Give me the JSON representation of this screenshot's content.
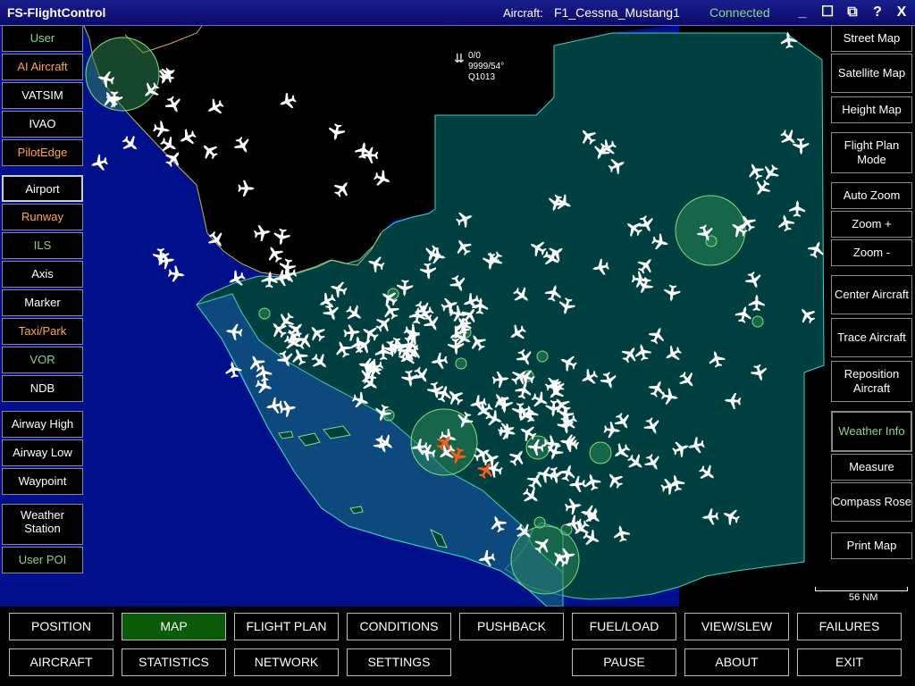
{
  "app_title": "FS-FlightControl",
  "aircraft_label": "Aircraft:",
  "aircraft_name": "F1_Cessna_Mustang1",
  "connection_status": "Connected",
  "window_buttons": [
    "_",
    "☐",
    "⧉",
    "?",
    "X"
  ],
  "left_panel": {
    "traffic": [
      "User",
      "AI Aircraft",
      "VATSIM",
      "IVAO",
      "PilotEdge"
    ],
    "nav": [
      "Airport",
      "Runway",
      "ILS",
      "Axis",
      "Marker",
      "Taxi/Park",
      "VOR",
      "NDB"
    ],
    "airways": [
      "Airway High",
      "Airway Low",
      "Waypoint"
    ],
    "weather_station": "Weather\nStation",
    "user_poi": "User POI"
  },
  "right_panel": {
    "street_map": "Street Map",
    "satellite_map": "Satellite Map",
    "height_map": "Height Map",
    "flight_plan_mode": "Flight Plan Mode",
    "auto_zoom": "Auto Zoom",
    "zoom_in": "Zoom +",
    "zoom_out": "Zoom -",
    "center_aircraft": "Center Aircraft",
    "trace_aircraft": "Trace Aircraft",
    "reposition_aircraft": "Reposition Aircraft",
    "weather_info": "Weather Info",
    "measure": "Measure",
    "compass_rose": "Compass Rose",
    "print_map": "Print Map"
  },
  "wind": {
    "line1": "0/0",
    "line2": "9999/54°",
    "line3": "Q1013"
  },
  "scale": "56 NM",
  "bottom_row1": [
    "POSITION",
    "MAP",
    "FLIGHT PLAN",
    "CONDITIONS",
    "PUSHBACK",
    "FUEL/LOAD",
    "VIEW/SLEW",
    "FAILURES"
  ],
  "bottom_row2": [
    "AIRCRAFT",
    "STATISTICS",
    "NETWORK",
    "SETTINGS",
    "",
    "PAUSE",
    "ABOUT",
    "EXIT"
  ],
  "active_tab": "MAP",
  "colors": {
    "title_bar": "#0a0a6a",
    "land": "#003f3f",
    "ocean": "#00108a",
    "airspace_fill": "#1a52b0",
    "airport_circle": "#2e8b57",
    "user_aircraft": "#ff5a1a",
    "ai_aircraft": "#ffffff",
    "active_tab": "#0a5a0a"
  }
}
